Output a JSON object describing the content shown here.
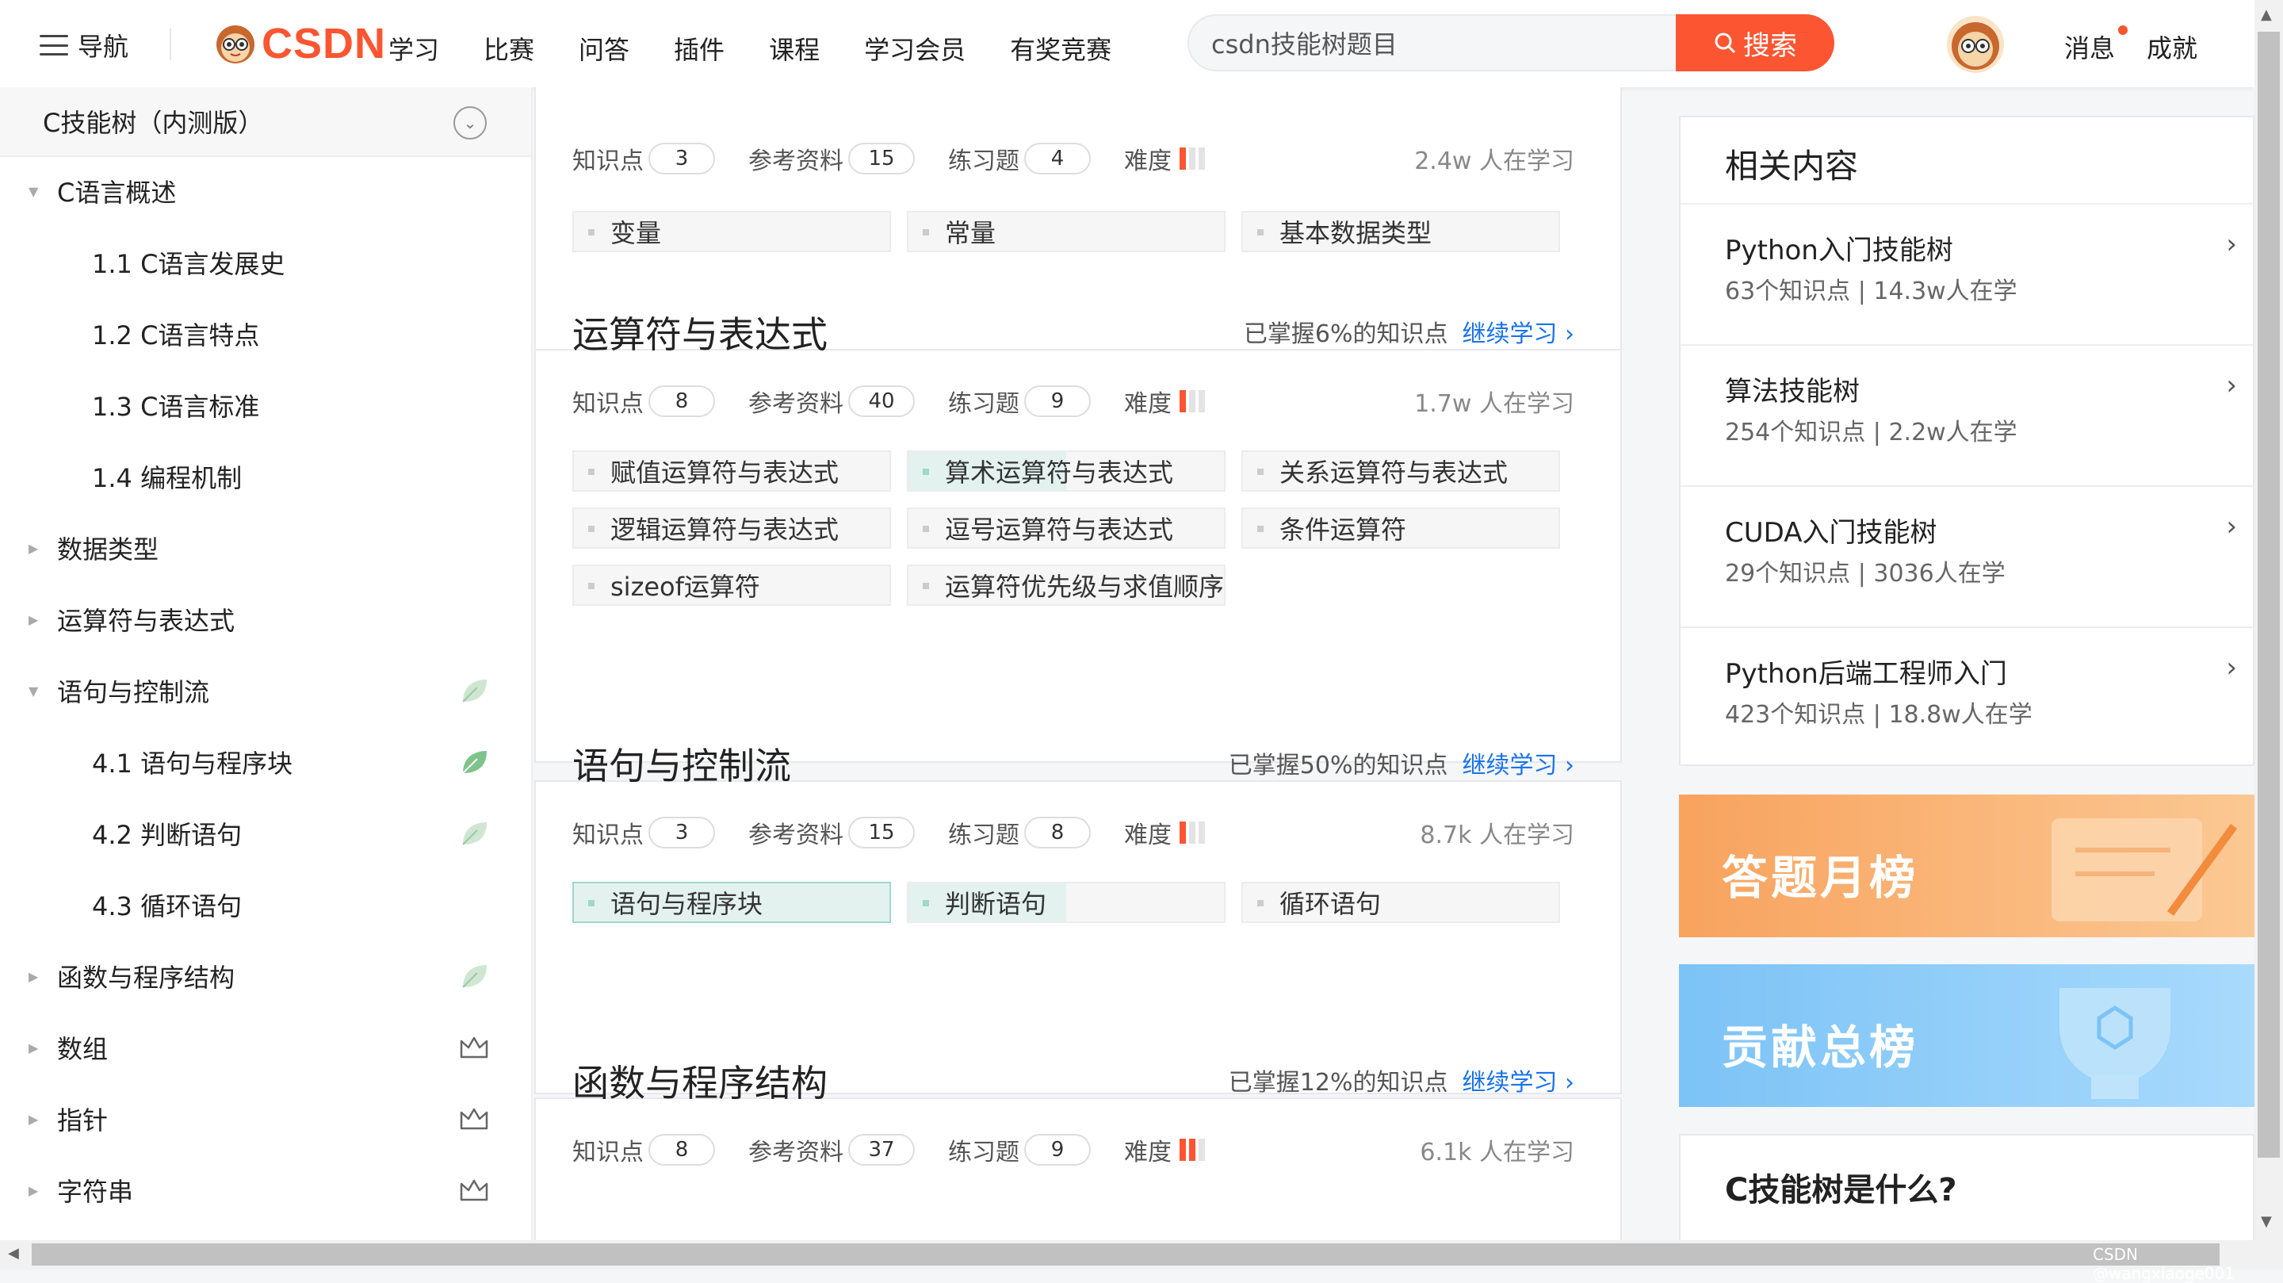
{
  "topbar": {
    "nav_label": "导航",
    "logo_text": "CSDN",
    "menu": [
      "学习",
      "比赛",
      "问答",
      "插件",
      "课程",
      "学习会员",
      "有奖竞赛"
    ],
    "search_placeholder": "csdn技能树题目",
    "search_button": "搜索",
    "messages": "消息",
    "achievements": "成就"
  },
  "sidebar": {
    "header": "C技能树（内测版）",
    "items": [
      {
        "label": "C语言概述",
        "level": 0,
        "expanded": true,
        "icon": ""
      },
      {
        "label": "1.1 C语言发展史",
        "level": 1,
        "icon": ""
      },
      {
        "label": "1.2 C语言特点",
        "level": 1,
        "icon": ""
      },
      {
        "label": "1.3 C语言标准",
        "level": 1,
        "icon": ""
      },
      {
        "label": "1.4 编程机制",
        "level": 1,
        "icon": ""
      },
      {
        "label": "数据类型",
        "level": 0,
        "expanded": false,
        "icon": ""
      },
      {
        "label": "运算符与表达式",
        "level": 0,
        "expanded": false,
        "icon": ""
      },
      {
        "label": "语句与控制流",
        "level": 0,
        "expanded": true,
        "icon": "leaf-outline-icon"
      },
      {
        "label": "4.1 语句与程序块",
        "level": 1,
        "icon": "leaf-filled-icon"
      },
      {
        "label": "4.2 判断语句",
        "level": 1,
        "icon": "leaf-outline-icon"
      },
      {
        "label": "4.3 循环语句",
        "level": 1,
        "icon": ""
      },
      {
        "label": "函数与程序结构",
        "level": 0,
        "expanded": false,
        "icon": "leaf-outline-icon"
      },
      {
        "label": "数组",
        "level": 0,
        "expanded": false,
        "icon": "crown-icon"
      },
      {
        "label": "指针",
        "level": 0,
        "expanded": false,
        "icon": "crown-icon"
      },
      {
        "label": "字符串",
        "level": 0,
        "expanded": false,
        "icon": "crown-icon"
      }
    ]
  },
  "cards": [
    {
      "title": "",
      "progress": "",
      "continue": "",
      "stats": {
        "kp_label": "知识点",
        "kp": "3",
        "ref_label": "参考资料",
        "ref": "15",
        "ex_label": "练习题",
        "ex": "4",
        "diff_label": "难度",
        "difficulty": 1
      },
      "learners": "2.4w 人在学习",
      "tags": [
        {
          "label": "变量",
          "state": "none"
        },
        {
          "label": "常量",
          "state": "none"
        },
        {
          "label": "基本数据类型",
          "state": "none"
        }
      ]
    },
    {
      "title": "运算符与表达式",
      "progress": "已掌握6%的知识点",
      "continue": "继续学习",
      "stats": {
        "kp_label": "知识点",
        "kp": "8",
        "ref_label": "参考资料",
        "ref": "40",
        "ex_label": "练习题",
        "ex": "9",
        "diff_label": "难度",
        "difficulty": 1
      },
      "learners": "1.7w 人在学习",
      "tags": [
        {
          "label": "赋值运算符与表达式",
          "state": "none"
        },
        {
          "label": "算术运算符与表达式",
          "state": "partial"
        },
        {
          "label": "关系运算符与表达式",
          "state": "none"
        },
        {
          "label": "逻辑运算符与表达式",
          "state": "none"
        },
        {
          "label": "逗号运算符与表达式",
          "state": "none"
        },
        {
          "label": "条件运算符",
          "state": "none"
        },
        {
          "label": "sizeof运算符",
          "state": "none"
        },
        {
          "label": "运算符优先级与求值顺序",
          "state": "none"
        }
      ]
    },
    {
      "title": "语句与控制流",
      "progress": "已掌握50%的知识点",
      "continue": "继续学习",
      "stats": {
        "kp_label": "知识点",
        "kp": "3",
        "ref_label": "参考资料",
        "ref": "15",
        "ex_label": "练习题",
        "ex": "8",
        "diff_label": "难度",
        "difficulty": 1
      },
      "learners": "8.7k 人在学习",
      "tags": [
        {
          "label": "语句与程序块",
          "state": "mastered"
        },
        {
          "label": "判断语句",
          "state": "partial"
        },
        {
          "label": "循环语句",
          "state": "none"
        }
      ]
    },
    {
      "title": "函数与程序结构",
      "progress": "已掌握12%的知识点",
      "continue": "继续学习",
      "stats": {
        "kp_label": "知识点",
        "kp": "8",
        "ref_label": "参考资料",
        "ref": "37",
        "ex_label": "练习题",
        "ex": "9",
        "diff_label": "难度",
        "difficulty": 2
      },
      "learners": "6.1k 人在学习",
      "tags": []
    }
  ],
  "related": {
    "title": "相关内容",
    "items": [
      {
        "name": "Python入门技能树",
        "meta": "63个知识点  |  14.3w人在学"
      },
      {
        "name": "算法技能树",
        "meta": "254个知识点  |  2.2w人在学"
      },
      {
        "name": "CUDA入门技能树",
        "meta": "29个知识点  |  3036人在学"
      },
      {
        "name": "Python后端工程师入门",
        "meta": "423个知识点  |  18.8w人在学"
      }
    ]
  },
  "banners": {
    "monthly": "答题月榜",
    "total": "贡献总榜"
  },
  "what_is": "C技能树是什么?",
  "watermark": "CSDN @wangxiaoge001",
  "colors": {
    "brand": "#fc5531",
    "link": "#1a73e8",
    "mastered": "#e4f2ef"
  }
}
